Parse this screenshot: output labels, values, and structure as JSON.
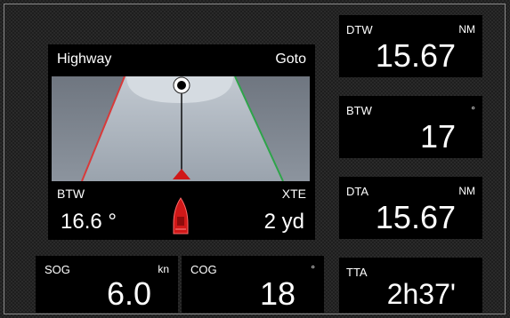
{
  "highway": {
    "title": "Highway",
    "goto": "Goto",
    "btw_label": "BTW",
    "btw_value": "16.6 °",
    "xte_label": "XTE",
    "xte_value": "2 yd"
  },
  "dtw": {
    "label": "DTW",
    "unit": "NM",
    "value": "15.67"
  },
  "btw": {
    "label": "BTW",
    "unit": "°",
    "value": "17"
  },
  "dta": {
    "label": "DTA",
    "unit": "NM",
    "value": "15.67"
  },
  "tta": {
    "label": "TTA",
    "value": "2h37'"
  },
  "sog": {
    "label": "SOG",
    "unit": "kn",
    "value": "6.0"
  },
  "cog": {
    "label": "COG",
    "unit": "°",
    "value": "18"
  },
  "colors": {
    "port_line": "#d83a3a",
    "starboard_line": "#2ea44a",
    "boat": "#d01818",
    "road": "#a9b2bd",
    "sky": "#7f8791"
  }
}
